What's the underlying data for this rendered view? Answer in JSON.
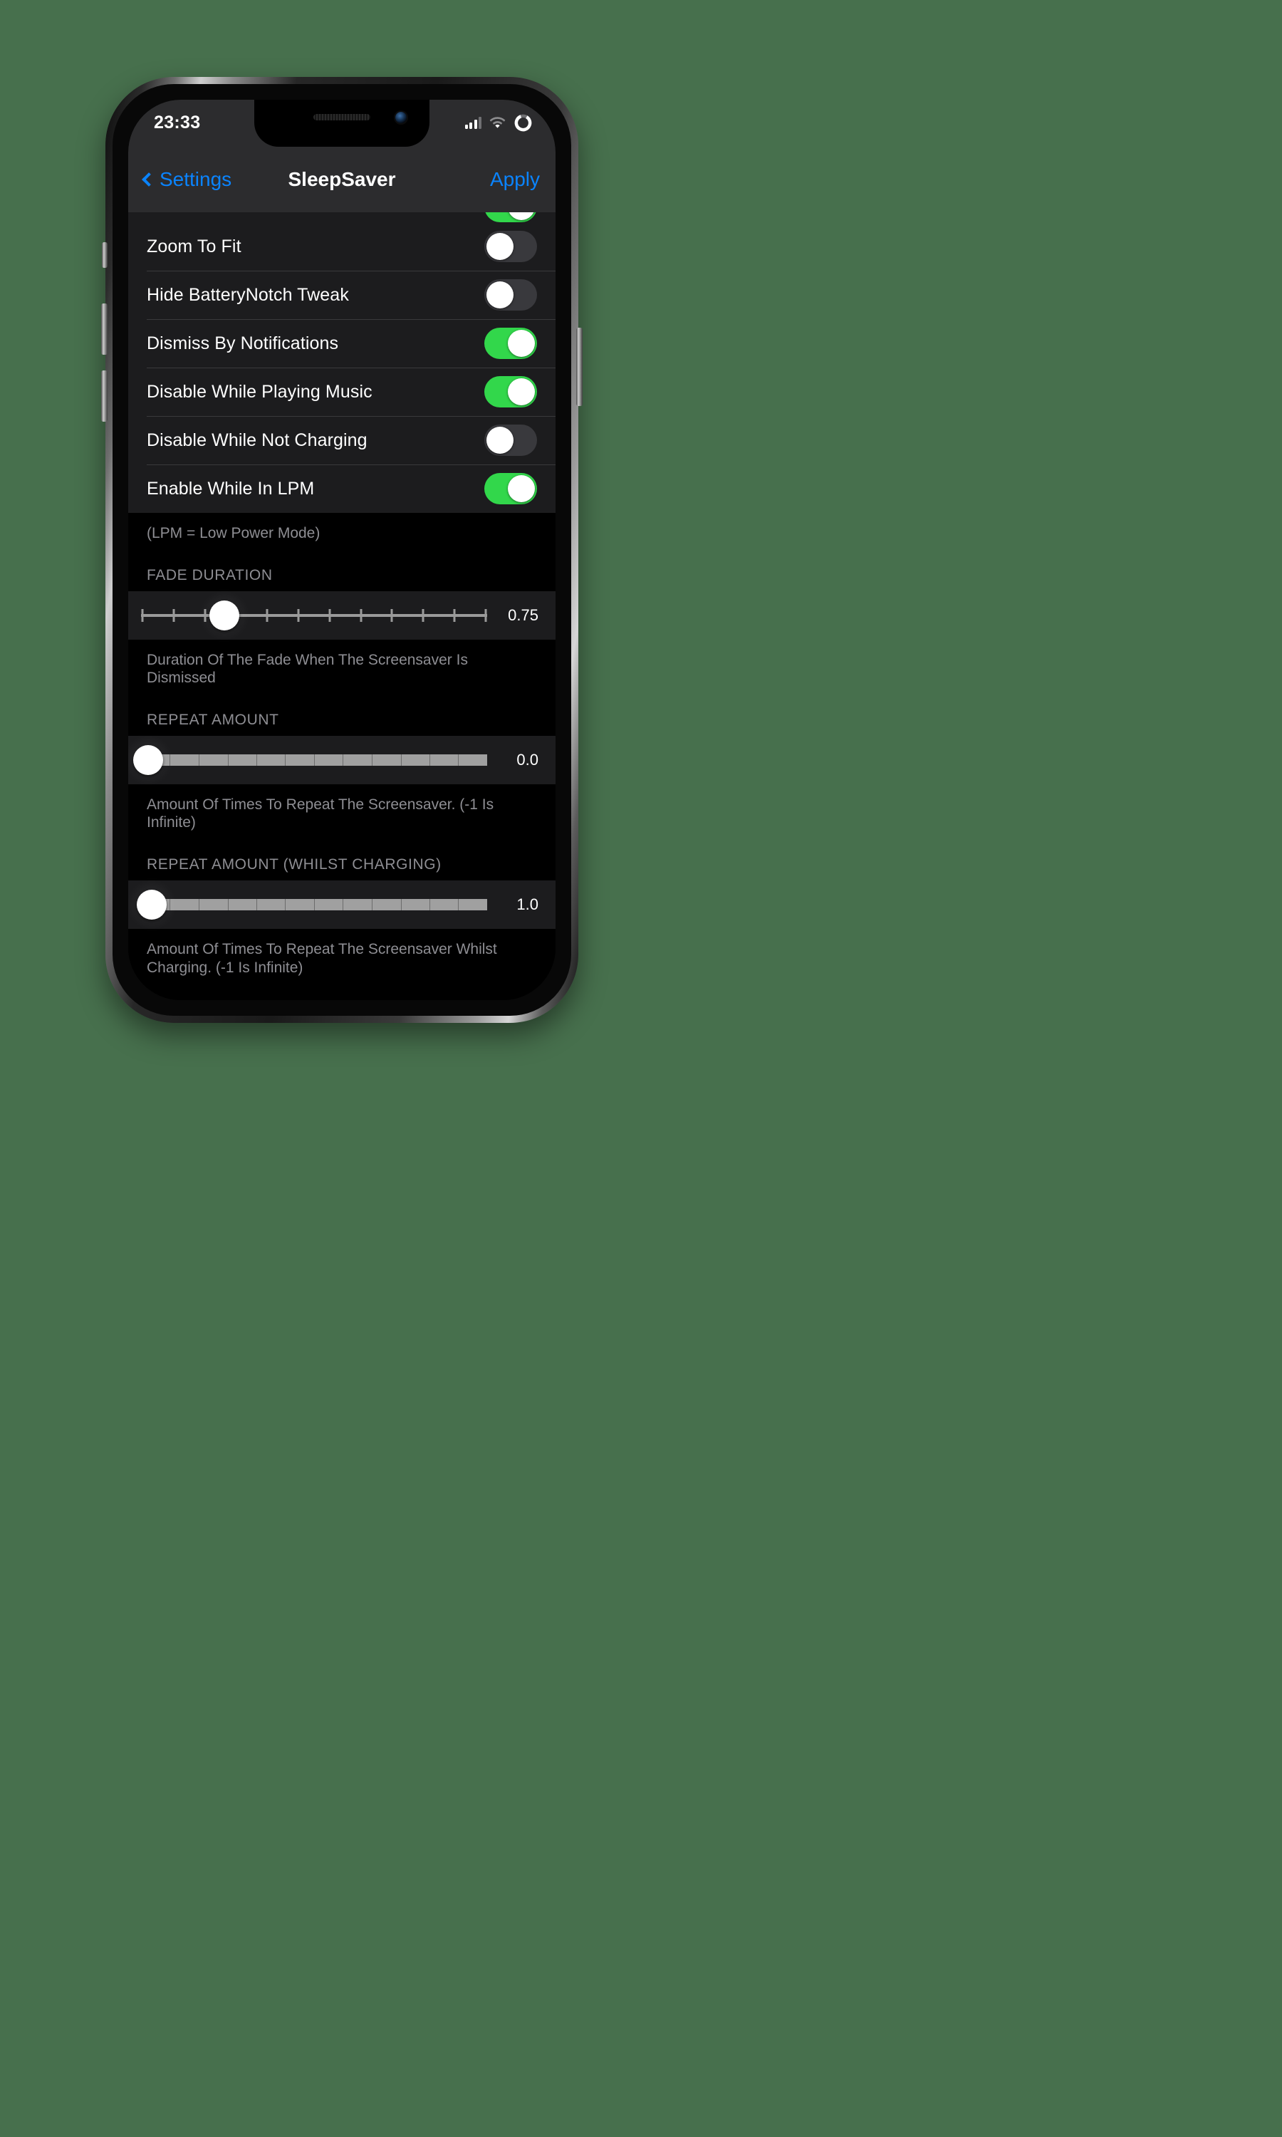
{
  "status_bar": {
    "time": "23:33",
    "icons": [
      "cellular-signal-icon",
      "wifi-icon",
      "battery-ring-icon"
    ]
  },
  "nav_bar": {
    "back_label": "Settings",
    "title": "SleepSaver",
    "apply_label": "Apply",
    "accent_color": "#0a84ff"
  },
  "colors": {
    "background": "#47704d",
    "screen_bg": "#000000",
    "row_bg": "#1c1c1e",
    "bar_bg": "#2c2c2e",
    "separator": "#3a3a3c",
    "toggle_on": "#32d74b",
    "toggle_off": "#39393d",
    "secondary_text": "#8e8e93"
  },
  "toggle_rows": [
    {
      "label": "Zoom To Fit",
      "state": "off"
    },
    {
      "label": "Hide BatteryNotch Tweak",
      "state": "off"
    },
    {
      "label": "Dismiss By Notifications",
      "state": "on"
    },
    {
      "label": "Disable While Playing Music",
      "state": "on"
    },
    {
      "label": "Disable While Not Charging",
      "state": "off"
    },
    {
      "label": "Enable While In LPM",
      "state": "on"
    }
  ],
  "notes": {
    "lpm": "(LPM = Low Power Mode)",
    "fade_duration": "Duration Of The Fade When The Screensaver Is Dismissed",
    "repeat_amount": "Amount Of Times To Repeat The Screensaver. (-1 Is Infinite)",
    "repeat_amount_charging": "Amount Of Times To Repeat The Screensaver Whilst Charging. (-1 Is Infinite)"
  },
  "sections": [
    {
      "header": "FADE DURATION",
      "slider": {
        "value": "0.75",
        "fill_percent": 25,
        "style": "ticks",
        "tick_count": 12
      }
    },
    {
      "header": "REPEAT AMOUNT",
      "slider": {
        "value": "0.0",
        "fill_percent": 2,
        "style": "segments",
        "tick_count": 11
      }
    },
    {
      "header": "REPEAT AMOUNT (WHILST CHARGING)",
      "slider": {
        "value": "1.0",
        "fill_percent": 3,
        "style": "segments",
        "tick_count": 11
      }
    }
  ]
}
